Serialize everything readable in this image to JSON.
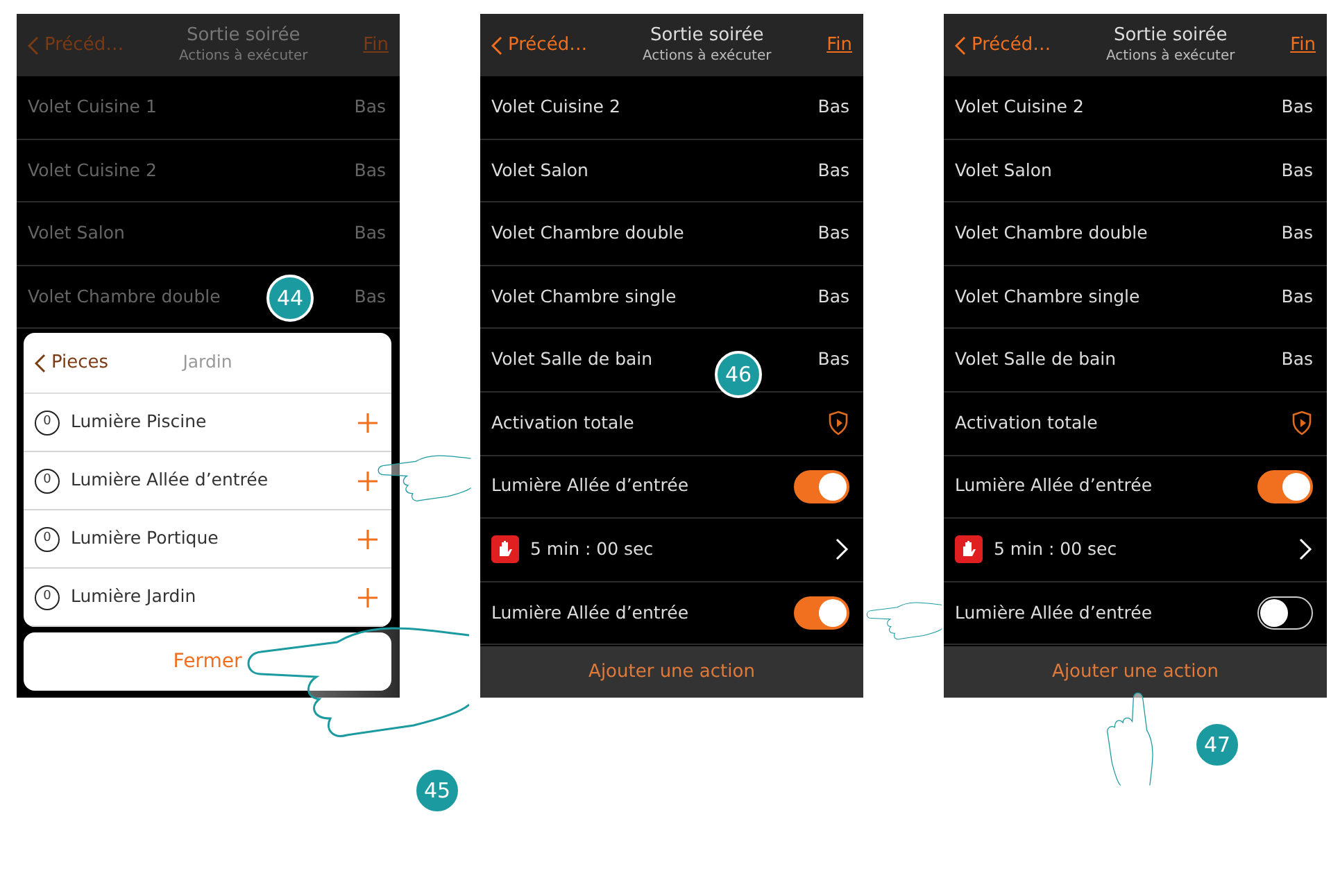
{
  "screens": [
    {
      "dimmed": true,
      "header": {
        "back": "Précéd…",
        "title": "Sortie soirée",
        "subtitle": "Actions à exécuter",
        "done": "Fin"
      },
      "rows": [
        {
          "kind": "value",
          "label": "Volet Cuisine 1",
          "value": "Bas"
        },
        {
          "kind": "value",
          "label": "Volet Cuisine 2",
          "value": "Bas"
        },
        {
          "kind": "value",
          "label": "Volet Salon",
          "value": "Bas"
        },
        {
          "kind": "value",
          "label": "Volet Chambre double",
          "value": "Bas"
        }
      ],
      "popup": {
        "back": "Pieces",
        "title": "Jardin",
        "items": [
          {
            "count": "0",
            "label": "Lumière Piscine"
          },
          {
            "count": "0",
            "label": "Lumière Allée d’entrée"
          },
          {
            "count": "0",
            "label": "Lumière Portique"
          },
          {
            "count": "0",
            "label": "Lumière Jardin"
          }
        ],
        "close": "Fermer"
      },
      "steps": [
        "44",
        "45"
      ]
    },
    {
      "dimmed": false,
      "header": {
        "back": "Précéd…",
        "title": "Sortie soirée",
        "subtitle": "Actions à exécuter",
        "done": "Fin"
      },
      "rows": [
        {
          "kind": "value",
          "label": "Volet Cuisine 2",
          "value": "Bas"
        },
        {
          "kind": "value",
          "label": "Volet Salon",
          "value": "Bas"
        },
        {
          "kind": "value",
          "label": "Volet Chambre double",
          "value": "Bas"
        },
        {
          "kind": "value",
          "label": "Volet Chambre single",
          "value": "Bas"
        },
        {
          "kind": "value",
          "label": "Volet Salle de bain",
          "value": "Bas"
        },
        {
          "kind": "alarm",
          "label": "Activation totale"
        },
        {
          "kind": "toggle",
          "label": "Lumière Allée d’entrée",
          "on": true
        },
        {
          "kind": "timer",
          "label": "5 min : 00 sec"
        },
        {
          "kind": "toggle",
          "label": "Lumière Allée d’entrée",
          "on": true
        }
      ],
      "footer": "Ajouter une action",
      "steps": [
        "46"
      ]
    },
    {
      "dimmed": false,
      "header": {
        "back": "Précéd…",
        "title": "Sortie soirée",
        "subtitle": "Actions à exécuter",
        "done": "Fin"
      },
      "rows": [
        {
          "kind": "value",
          "label": "Volet Cuisine 2",
          "value": "Bas"
        },
        {
          "kind": "value",
          "label": "Volet Salon",
          "value": "Bas"
        },
        {
          "kind": "value",
          "label": "Volet Chambre double",
          "value": "Bas"
        },
        {
          "kind": "value",
          "label": "Volet Chambre single",
          "value": "Bas"
        },
        {
          "kind": "value",
          "label": "Volet Salle de bain",
          "value": "Bas"
        },
        {
          "kind": "alarm",
          "label": "Activation totale"
        },
        {
          "kind": "toggle",
          "label": "Lumière Allée d’entrée",
          "on": true
        },
        {
          "kind": "timer",
          "label": "5 min : 00 sec"
        },
        {
          "kind": "toggle",
          "label": "Lumière Allée d’entrée",
          "on": false
        }
      ],
      "footer": "Ajouter une action",
      "steps": [
        "47"
      ]
    }
  ]
}
